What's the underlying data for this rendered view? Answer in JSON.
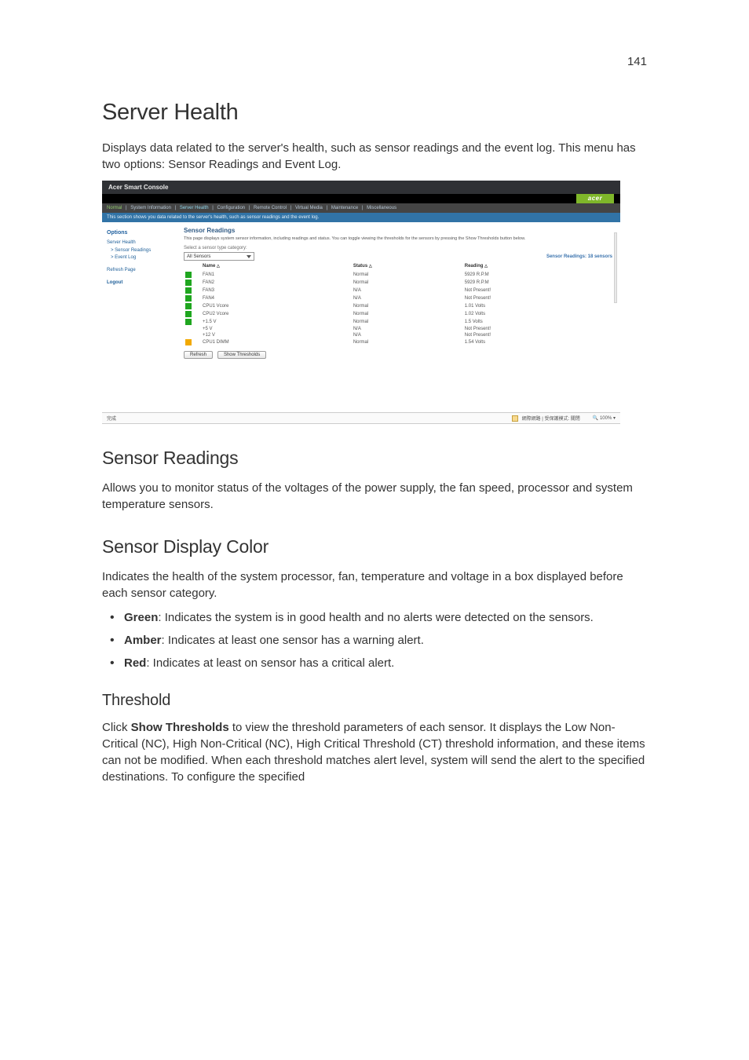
{
  "page_number": "141",
  "h1": "Server Health",
  "intro": "Displays data related to the server's health, such as sensor readings and the event log. This menu has two options: Sensor Readings and Event Log.",
  "sections": {
    "sensor_readings": {
      "heading": "Sensor Readings",
      "body": "Allows you to monitor status of the voltages of the power supply, the fan speed, processor and system temperature sensors."
    },
    "sensor_display_color": {
      "heading": "Sensor Display Color",
      "body": "Indicates the health of the system processor, fan, temperature and voltage in a box displayed before each sensor category."
    },
    "threshold": {
      "heading": "Threshold",
      "lead_strong": "Show Thresholds",
      "body_pre": "Click ",
      "body_post": " to view the threshold parameters of each sensor. It displays the Low Non-Critical (NC), High Non-Critical (NC), High Critical Threshold (CT) threshold information, and these items can not be modified. When each threshold matches alert level, system will send the alert to the specified destinations. To configure the specified"
    }
  },
  "bullets": {
    "green": {
      "label": "Green",
      "text": ": Indicates the system is in good health and no alerts were detected on the sensors."
    },
    "amber": {
      "label": "Amber",
      "text": ": Indicates at least one sensor has a warning alert."
    },
    "red": {
      "label": "Red",
      "text": ": Indicates at least on sensor has a critical alert."
    }
  },
  "screenshot": {
    "window_title": "Acer Smart Console",
    "brand": "acer",
    "tabs": {
      "status_dot": "Normal",
      "items": [
        "System Information",
        "Server Health",
        "Configuration",
        "Remote Control",
        "Virtual Media",
        "Maintenance",
        "Miscellaneous"
      ],
      "active": "Server Health"
    },
    "blue_strip": "This section shows you data related to the server's health, such as sensor readings and the event log.",
    "sidebar": {
      "options": "Options",
      "server_health": "Server Health",
      "items": [
        "Sensor Readings",
        "Event Log"
      ],
      "refresh": "Refresh Page",
      "logout": "Logout"
    },
    "main": {
      "title": "Sensor Readings",
      "desc": "This page displays system sensor information, including readings and status. You can toggle viewing the thresholds for the sensors by pressing the Show Thresholds button below.",
      "select_label": "Select a sensor type category:",
      "select_value": "All Sensors",
      "count": "Sensor Readings: 18 sensors",
      "headers": {
        "name": "Name",
        "status": "Status",
        "reading": "Reading"
      },
      "rows": [
        {
          "swatch": "green",
          "name": "FAN1",
          "status": "Normal",
          "reading": "5929 R.P.M"
        },
        {
          "swatch": "green",
          "name": "FAN2",
          "status": "Normal",
          "reading": "5929 R.P.M"
        },
        {
          "swatch": "green",
          "name": "FAN3",
          "status": "N/A",
          "reading": "Not Present!"
        },
        {
          "swatch": "green",
          "name": "FAN4",
          "status": "N/A",
          "reading": "Not Present!"
        },
        {
          "swatch": "green",
          "name": "CPU1 Vcore",
          "status": "Normal",
          "reading": "1.01 Volts"
        },
        {
          "swatch": "green",
          "name": "CPU2 Vcore",
          "status": "Normal",
          "reading": "1.02 Volts"
        },
        {
          "swatch": "green",
          "name": "+1.5 V",
          "status": "Normal",
          "reading": "1.5 Volts"
        },
        {
          "swatch": "",
          "name": "+5 V",
          "status": "N/A",
          "reading": "Not Present!"
        },
        {
          "swatch": "",
          "name": "+12 V",
          "status": "N/A",
          "reading": "Not Present!"
        },
        {
          "swatch": "amber",
          "name": "CPU1 DIMM",
          "status": "Normal",
          "reading": "1.54 Volts"
        }
      ],
      "buttons": {
        "refresh": "Refresh",
        "show_thresholds": "Show Thresholds"
      }
    },
    "statusbar": {
      "left": "完成",
      "zone_text": "網際網路 | 受保護模式: 關閉",
      "zoom": "100%"
    }
  }
}
